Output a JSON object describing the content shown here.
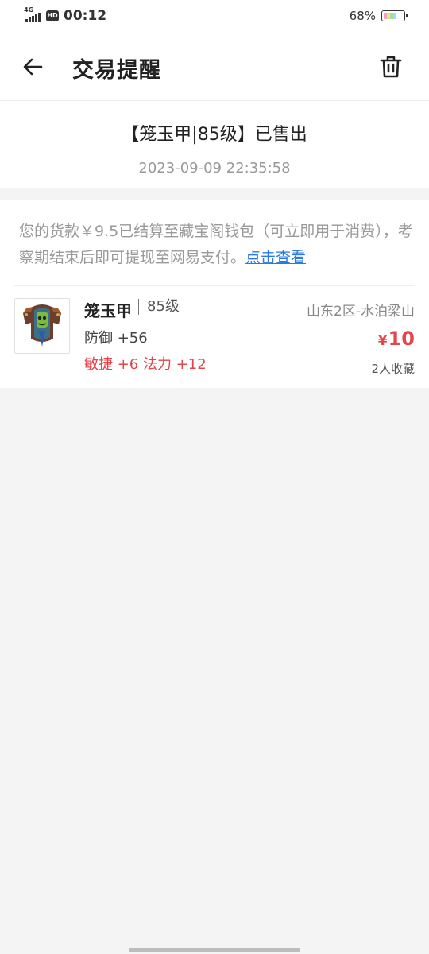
{
  "status_bar": {
    "network": "4G",
    "hd": "HD",
    "time": "00:12",
    "battery_percent": "68%",
    "battery_level": 0.68
  },
  "header": {
    "title": "交易提醒",
    "back_icon": "arrow-left-icon",
    "delete_icon": "trash-icon"
  },
  "message": {
    "title": "【笼玉甲|85级】已售出",
    "time": "2023-09-09 22:35:58"
  },
  "notice": {
    "text": "您的货款￥9.5已结算至藏宝阁钱包（可立即用于消费），考察期结束后即可提现至网易支付。",
    "link": "点击查看"
  },
  "item": {
    "name": "笼玉甲",
    "level": "85级",
    "attr1": "防御 +56",
    "attr2": "敏捷 +6 法力 +12",
    "server": "山东2区-水泊梁山",
    "currency": "¥",
    "price": "10",
    "favorites": "2人收藏"
  },
  "colors": {
    "price_red": "#e5454a",
    "link_blue": "#2a7ae2"
  }
}
